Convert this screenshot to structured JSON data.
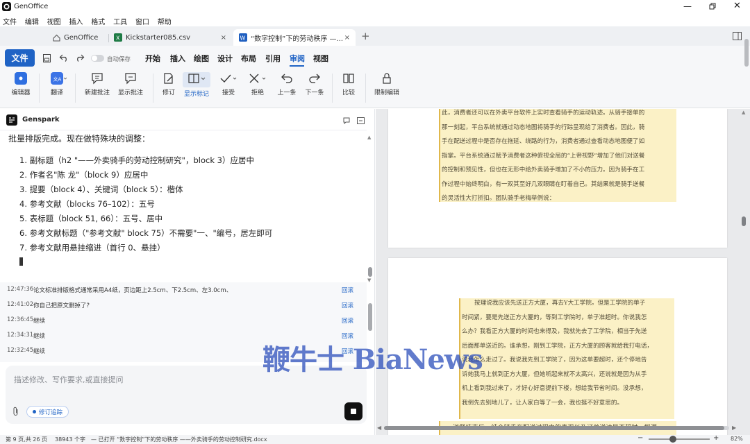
{
  "app": {
    "name": "GenOffice"
  },
  "menu": [
    "文件",
    "编辑",
    "视图",
    "插入",
    "格式",
    "工具",
    "窗口",
    "帮助"
  ],
  "tabs": [
    {
      "label": "GenOffice",
      "icon": "home-icon"
    },
    {
      "label": "Kickstarter085.csv",
      "icon": "excel-icon",
      "close": "×"
    },
    {
      "label": "“数字控制”下的劳动秩序 —...",
      "icon": "word-icon",
      "close": "×"
    }
  ],
  "new_tab": "+",
  "ribbon": {
    "file_button": "文件",
    "autosave": "自动保存",
    "tabs": [
      "开始",
      "插入",
      "绘图",
      "设计",
      "布局",
      "引用",
      "审阅",
      "视图"
    ],
    "active_tab": "审阅",
    "tools": [
      "编辑器",
      "翻译",
      "新建批注",
      "显示批注",
      "修订",
      "显示标记",
      "接受",
      "拒绝",
      "上一条",
      "下一条",
      "比较",
      "限制编辑"
    ]
  },
  "chat": {
    "title": "Genspark",
    "intro": "批量排版完成。现在做特殊块的调整：",
    "plan": [
      "1. 副标题（h2 \"——外卖骑手的劳动控制研究\"，block 3）应居中",
      "2. 作者名\"陈 龙\"（block 9）应居中",
      "3. 提要（block 4）、关键词（block 5）：楷体",
      "4. 参考文献（blocks 76–102）：五号",
      "5. 表标题（block 51, 66）：五号、居中",
      "6. 参考文献标题（\"参考文献\" block 75）不需要\"一、\"编号，居左即可",
      "7. 参考文献用悬挂缩进（首行 0、悬挂）"
    ],
    "history": [
      {
        "time": "12:47:36",
        "msg": "论文标准排版格式通常采用A4纸，页边距上2.5cm、下2.5cm、左3.0cm、",
        "action": "回滚"
      },
      {
        "time": "12:41:02",
        "msg": "你自己把原文删掉了?",
        "action": "回滚"
      },
      {
        "time": "12:36:45",
        "msg": "继续",
        "action": "回滚"
      },
      {
        "time": "12:34:31",
        "msg": "继续",
        "action": "回滚"
      },
      {
        "time": "12:32:45",
        "msg": "继续",
        "action": "回滚"
      }
    ],
    "input_placeholder": "描述修改、写作要求,或直接提问",
    "track_badge": "修订追踪"
  },
  "document": {
    "page1_lines": [
      "此，消费者还可以在外卖平台软件上实时查看骑手的运动轨迹。从骑手接单的",
      "那一刻起，平台系统就通过动态地图将骑手的行踪呈现给了消费者。因此，骑",
      "手在配送过程中是否存在拖延、绕路的行为，消费者通过查看动态地图便了如",
      "指掌。平台系统通过赋予消费者这种俯视全局的“上帝视野”增加了他们对送餐",
      "的控制和预见性，但也在无形中给外卖骑手增加了不小的压力。因为骑手在工",
      "作过程中始终明白，有一双其至好几双眼睛在盯着自己。其结果就是骑手送餐",
      "的灵活性大打折扣。团队骑手老梅举例说："
    ],
    "page2_quote": [
      "按理说我应该先送正方大厦，再去Y大工学院。但是工学院的单子",
      "时间紧，要是先送正方大厦的，等到工学院时，单子准超时。你说我怎",
      "么办？我看正方大厦的时间也来得及，我就先去了工学院，相当于先送",
      "后面那单送近的。谁承想，刚到工学院，正方大厦的顾客就给我打电话，",
      "说我怎么走过了。我说我先到工学院了，因为这单要超时，还个停地告",
      "诉她我马上就到正方大厦，但她听起来就不太高兴，还说就是因为从手",
      "机上看到我过来了，才好心好意提前下楼，想给我节省时间。没承想，",
      "我倒先去别地儿了，让人家白等了一会，我也挺不好意思的。"
    ],
    "page2_tail": "送餐结束后，结合骑手在配送过程中的表现以及订单送达是否超时、搬漏"
  },
  "watermark": "鞭牛士 BiaNews",
  "status": {
    "page": "第 9 页,共 26 页",
    "words": "38943 个字",
    "opened": "— 已打开 “数字控制”下的劳动秩序 ——外卖骑手的劳动控制研究.docx",
    "zoom": "82%",
    "zoom_fraction": 0.4
  },
  "colors": {
    "accent": "#1f63c5",
    "highlight": "#fbf1c6"
  }
}
